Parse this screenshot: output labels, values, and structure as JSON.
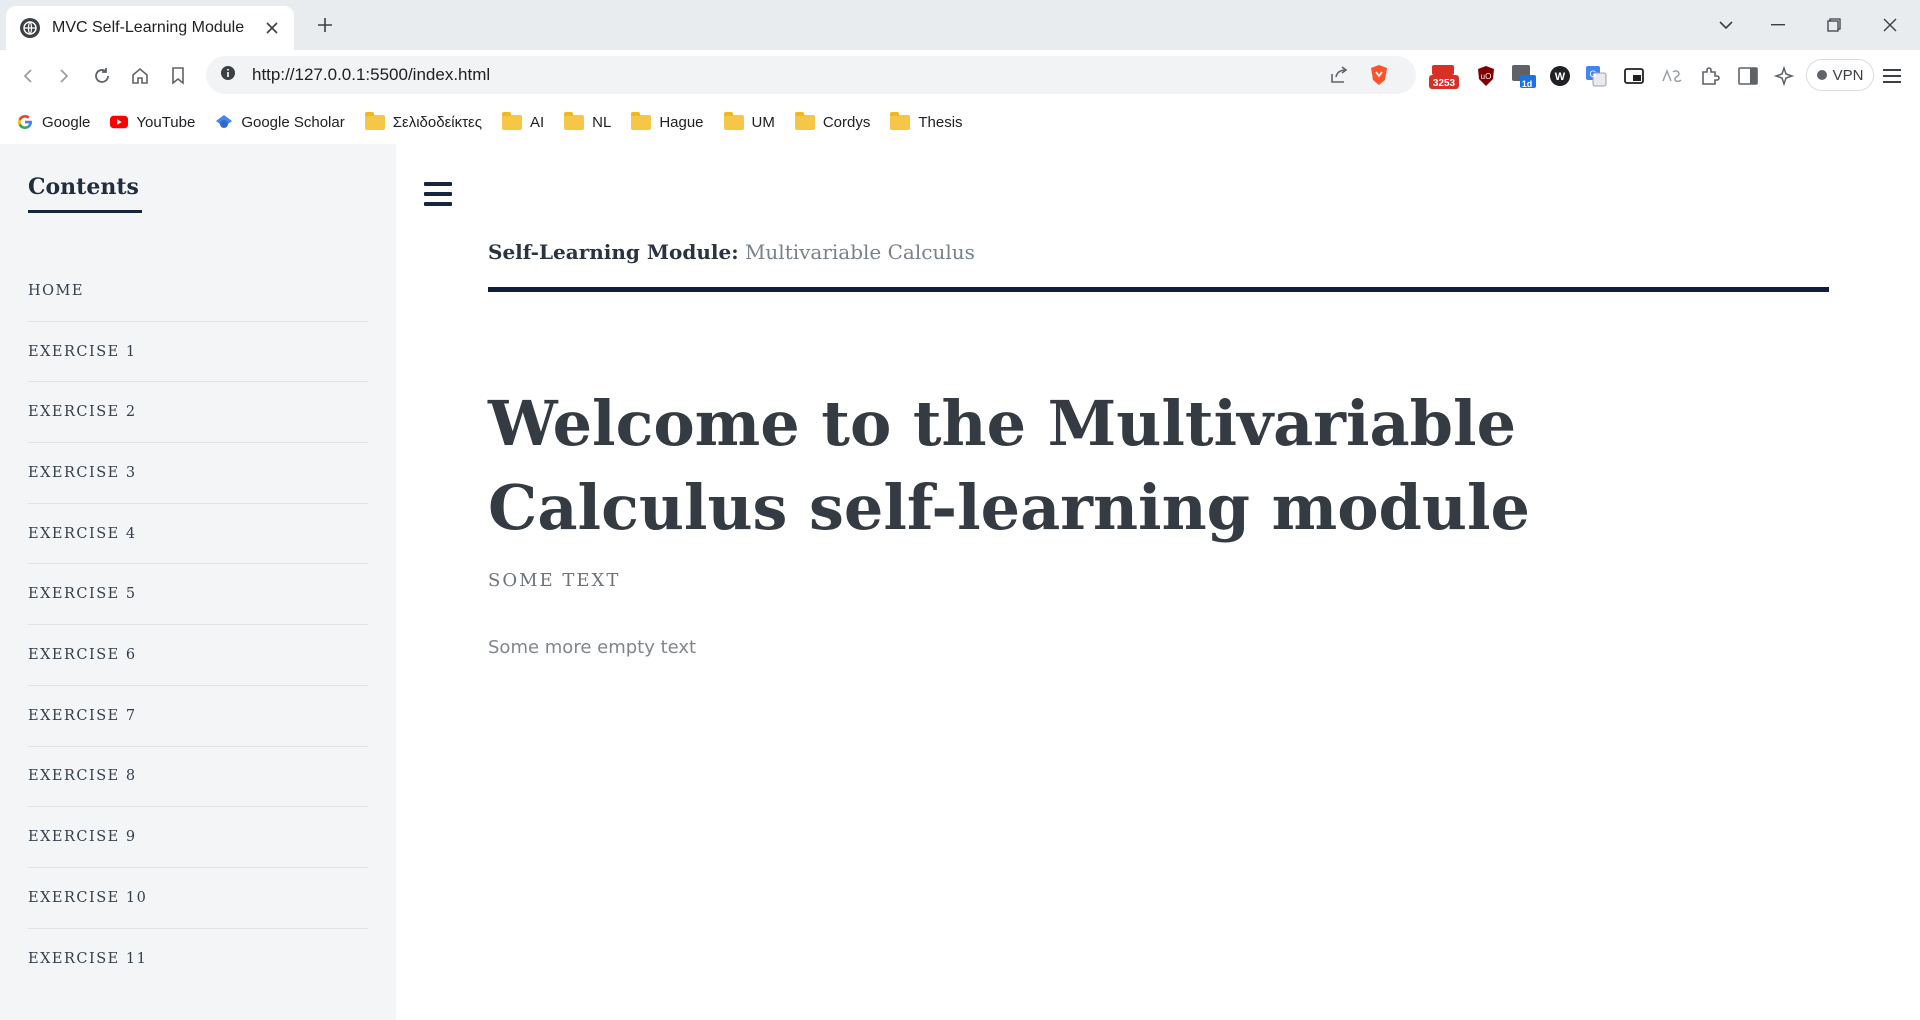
{
  "browser": {
    "tab_title": "MVC Self-Learning Module",
    "url": "http://127.0.0.1:5500/index.html",
    "extension_badges": {
      "gift": "3253",
      "calendar": "1d"
    },
    "vpn_label": "VPN",
    "bookmarks": [
      {
        "label": "Google",
        "icon": "google-icon"
      },
      {
        "label": "YouTube",
        "icon": "youtube-icon"
      },
      {
        "label": "Google Scholar",
        "icon": "scholar-icon"
      },
      {
        "label": "Σελιδοδείκτες",
        "icon": "folder-icon"
      },
      {
        "label": "AI",
        "icon": "folder-icon"
      },
      {
        "label": "NL",
        "icon": "folder-icon"
      },
      {
        "label": "Hague",
        "icon": "folder-icon"
      },
      {
        "label": "UM",
        "icon": "folder-icon"
      },
      {
        "label": "Cordys",
        "icon": "folder-icon"
      },
      {
        "label": "Thesis",
        "icon": "folder-icon"
      }
    ]
  },
  "sidebar": {
    "title": "Contents",
    "items": [
      {
        "label": "HOME"
      },
      {
        "label": "EXERCISE 1"
      },
      {
        "label": "EXERCISE 2"
      },
      {
        "label": "EXERCISE 3"
      },
      {
        "label": "EXERCISE 4"
      },
      {
        "label": "EXERCISE 5"
      },
      {
        "label": "EXERCISE 6"
      },
      {
        "label": "EXERCISE 7"
      },
      {
        "label": "EXERCISE 8"
      },
      {
        "label": "EXERCISE 9"
      },
      {
        "label": "EXERCISE 10"
      },
      {
        "label": "EXERCISE 11"
      }
    ]
  },
  "main": {
    "module_label": "Self-Learning Module:",
    "module_name": "Multivariable Calculus",
    "heading": "Welcome to the Multivariable Calculus self-learning module",
    "subheading": "SOME TEXT",
    "body": "Some more empty text"
  },
  "colors": {
    "accent": "#0f1f3a",
    "sidebar_bg": "#f4f5f7",
    "heading": "#343b42"
  }
}
